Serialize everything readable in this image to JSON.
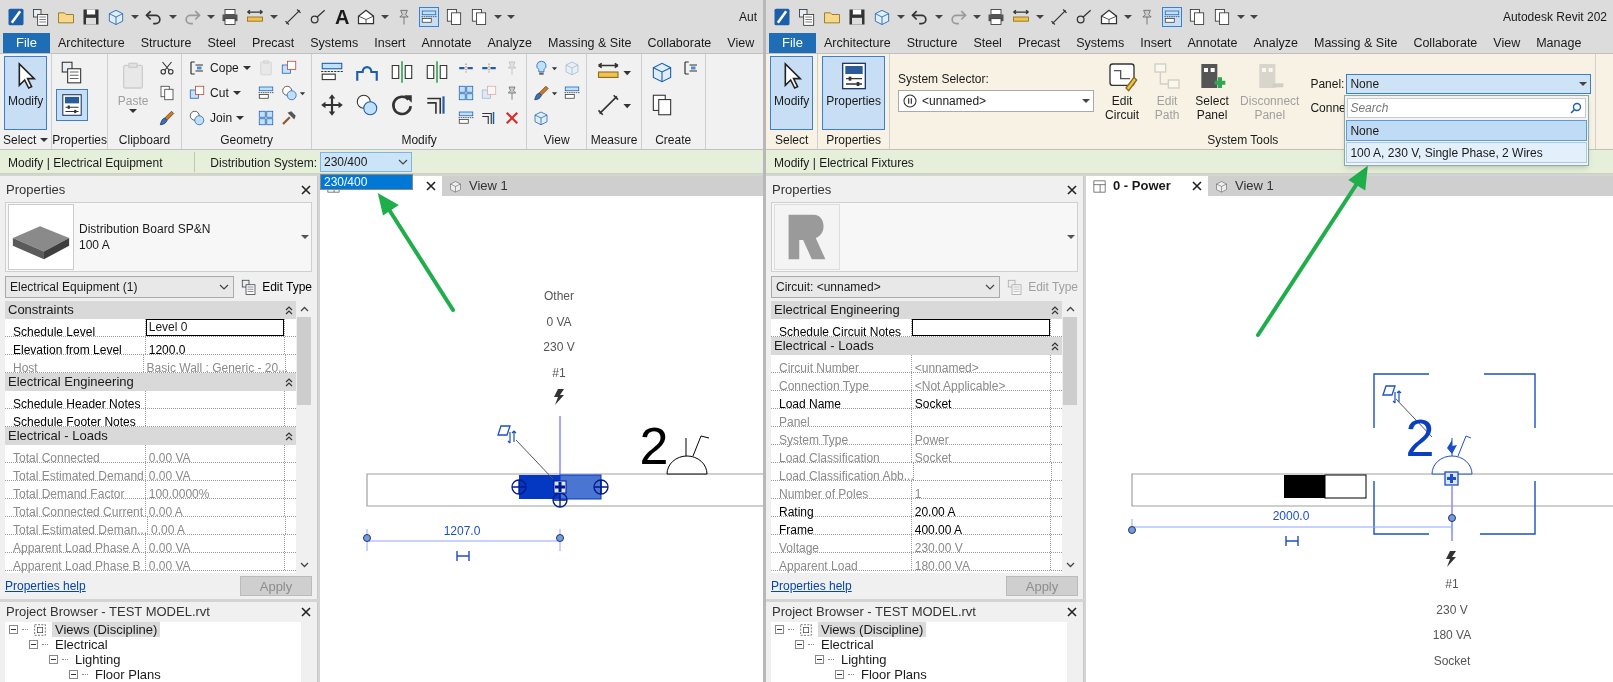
{
  "windows": [
    {
      "kind": "equipment",
      "title": "Aut",
      "text_tool": "A",
      "ribbon_tabs": [
        {
          "label": "File",
          "kind": "file",
          "selected": false
        },
        {
          "label": "Architecture",
          "kind": "tab",
          "selected": false
        },
        {
          "label": "Structure",
          "kind": "tab",
          "selected": false
        },
        {
          "label": "Steel",
          "kind": "tab",
          "selected": false
        },
        {
          "label": "Precast",
          "kind": "tab",
          "selected": false
        },
        {
          "label": "Systems",
          "kind": "tab",
          "selected": false
        },
        {
          "label": "Insert",
          "kind": "tab",
          "selected": false
        },
        {
          "label": "Annotate",
          "kind": "tab",
          "selected": false
        },
        {
          "label": "Analyze",
          "kind": "tab",
          "selected": false
        },
        {
          "label": "Massing & Site",
          "kind": "tab",
          "selected": false
        },
        {
          "label": "Collaborate",
          "kind": "tab",
          "selected": false
        },
        {
          "label": "View",
          "kind": "tab",
          "selected": false
        }
      ],
      "ribbon_panels": [
        {
          "title": "Select",
          "title_dropdown": true,
          "columns": [
            [
              {
                "kind": "large",
                "label": "Modify",
                "active": true,
                "disabled": false,
                "dropdown": false
              }
            ]
          ]
        },
        {
          "title": "Properties",
          "title_dropdown": false,
          "columns": [
            [
              {
                "kind": "medium",
                "active": false,
                "disabled": false,
                "dropdown": false
              },
              {
                "kind": "medium",
                "active": true,
                "disabled": false,
                "dropdown": false
              }
            ]
          ]
        },
        {
          "title": "Clipboard",
          "title_dropdown": false,
          "columns": [
            [
              {
                "kind": "large",
                "label": "Paste",
                "active": false,
                "disabled": true,
                "dropdown": true
              }
            ],
            [
              {
                "kind": "icon",
                "active": false,
                "disabled": false,
                "dropdown": false
              },
              {
                "kind": "icon",
                "active": false,
                "disabled": false,
                "dropdown": false
              },
              {
                "kind": "icon",
                "active": false,
                "disabled": false,
                "dropdown": false
              }
            ]
          ]
        },
        {
          "title": "Geometry",
          "title_dropdown": false,
          "columns": [
            [
              {
                "kind": "small",
                "label": "Cope",
                "active": false,
                "disabled": false,
                "dropdown": true
              },
              {
                "kind": "small",
                "label": "Cut",
                "active": false,
                "disabled": false,
                "dropdown": true
              },
              {
                "kind": "small",
                "label": "Join",
                "active": false,
                "disabled": false,
                "dropdown": true
              }
            ],
            [
              {
                "kind": "icon",
                "active": false,
                "disabled": true,
                "dropdown": false
              },
              {
                "kind": "icon",
                "active": false,
                "disabled": false,
                "dropdown": false
              },
              {
                "kind": "icon",
                "active": false,
                "disabled": false,
                "dropdown": false
              }
            ],
            [
              {
                "kind": "icon",
                "active": false,
                "disabled": false,
                "dropdown": false
              },
              {
                "kind": "icon",
                "active": false,
                "disabled": false,
                "dropdown": true
              },
              {
                "kind": "icon",
                "active": false,
                "disabled": false,
                "dropdown": false
              }
            ]
          ]
        },
        {
          "title": "Modify",
          "title_dropdown": false,
          "columns": [
            [
              {
                "kind": "medium",
                "active": false,
                "disabled": false,
                "dropdown": false
              },
              {
                "kind": "medium",
                "active": false,
                "disabled": false,
                "dropdown": false
              }
            ],
            [
              {
                "kind": "medium",
                "active": false,
                "disabled": false,
                "dropdown": false
              },
              {
                "kind": "medium",
                "active": false,
                "disabled": false,
                "dropdown": false
              }
            ],
            [
              {
                "kind": "medium",
                "active": false,
                "disabled": false,
                "dropdown": false
              },
              {
                "kind": "medium",
                "active": false,
                "disabled": false,
                "dropdown": false
              }
            ],
            [
              {
                "kind": "medium",
                "active": false,
                "disabled": false,
                "dropdown": false
              },
              {
                "kind": "medium",
                "active": false,
                "disabled": false,
                "dropdown": false
              }
            ],
            [
              {
                "kind": "icon",
                "active": false,
                "disabled": false,
                "dropdown": false
              },
              {
                "kind": "icon",
                "active": false,
                "disabled": false,
                "dropdown": false
              },
              {
                "kind": "icon",
                "active": false,
                "disabled": false,
                "dropdown": false
              }
            ],
            [
              {
                "kind": "icon",
                "active": false,
                "disabled": false,
                "dropdown": false
              },
              {
                "kind": "icon",
                "active": false,
                "disabled": true,
                "dropdown": false
              },
              {
                "kind": "icon",
                "active": false,
                "disabled": false,
                "dropdown": false
              }
            ],
            [
              {
                "kind": "icon",
                "active": false,
                "disabled": true,
                "dropdown": false
              },
              {
                "kind": "icon",
                "active": false,
                "disabled": false,
                "dropdown": false
              },
              {
                "kind": "icon",
                "active": false,
                "disabled": false,
                "dropdown": false
              }
            ]
          ]
        },
        {
          "title": "View",
          "title_dropdown": false,
          "columns": [
            [
              {
                "kind": "icon",
                "active": false,
                "disabled": false,
                "dropdown": true
              },
              {
                "kind": "icon",
                "active": false,
                "disabled": false,
                "dropdown": true
              },
              {
                "kind": "icon",
                "active": false,
                "disabled": false,
                "dropdown": false
              }
            ],
            [
              {
                "kind": "icon",
                "active": false,
                "disabled": true,
                "dropdown": false
              },
              {
                "kind": "icon",
                "active": false,
                "disabled": false,
                "dropdown": false
              }
            ]
          ]
        },
        {
          "title": "Measure",
          "title_dropdown": false,
          "columns": [
            [
              {
                "kind": "medium",
                "active": false,
                "disabled": false,
                "dropdown": true
              },
              {
                "kind": "medium",
                "active": false,
                "disabled": false,
                "dropdown": true
              }
            ]
          ]
        },
        {
          "title": "Create",
          "title_dropdown": false,
          "columns": [
            [
              {
                "kind": "medium",
                "active": false,
                "disabled": false,
                "dropdown": false
              },
              {
                "kind": "medium",
                "active": false,
                "disabled": false,
                "dropdown": false
              }
            ],
            [
              {
                "kind": "icon",
                "active": false,
                "disabled": false,
                "dropdown": false
              }
            ]
          ]
        }
      ],
      "context_bar": {
        "label": "Modify | Electrical Equipment",
        "field_label": "Distribution System:",
        "value": "230/400",
        "options": [
          {
            "label": "230/400",
            "selected": true
          }
        ]
      },
      "properties": {
        "title": "Properties",
        "type_name": "Distribution Board SP&N",
        "type_detail": "100 A",
        "filter": "Electrical Equipment (1)",
        "edit_type": {
          "label": "Edit Type",
          "disabled": false
        },
        "groups": [
          {
            "title": "Constraints",
            "rows": [
              {
                "name": "Schedule Level",
                "value": "Level 0",
                "editable": true,
                "focused": true
              },
              {
                "name": "Elevation from Level",
                "value": "1200.0",
                "editable": true,
                "focused": false
              },
              {
                "name": "Host",
                "value": "Basic Wall : Generic - 20...",
                "editable": false,
                "focused": false
              }
            ]
          },
          {
            "title": "Electrical Engineering",
            "rows": [
              {
                "name": "Schedule Header Notes",
                "editable": true,
                "focused": false
              },
              {
                "name": "Schedule Footer Notes",
                "editable": true,
                "focused": false
              }
            ]
          },
          {
            "title": "Electrical - Loads",
            "rows": [
              {
                "name": "Total Connected",
                "value": "0.00 VA",
                "editable": false,
                "focused": false
              },
              {
                "name": "Total Estimated Demand",
                "value": "0.00 VA",
                "editable": false,
                "focused": false
              },
              {
                "name": "Total Demand Factor",
                "value": "100.0000%",
                "editable": false,
                "focused": false
              },
              {
                "name": "Total Connected Current",
                "value": "0.00 A",
                "editable": false,
                "focused": false
              },
              {
                "name": "Total Estimated Deman...",
                "value": "0.00 A",
                "editable": false,
                "focused": false
              },
              {
                "name": "Apparent Load Phase A",
                "value": "0.00 VA",
                "editable": false,
                "focused": false
              },
              {
                "name": "Apparent Load Phase B",
                "value": "0.00 VA",
                "editable": false,
                "focused": false
              }
            ]
          }
        ],
        "help": "Properties help",
        "apply": {
          "label": "Apply",
          "disabled": true
        }
      },
      "project_browser": {
        "title": "Project Browser - TEST MODEL.rvt",
        "tree": [
          {
            "label": "Views (Discipline)",
            "expanded": true,
            "selected": true,
            "children": [
              {
                "label": "Electrical",
                "expanded": true,
                "selected": false,
                "children": [
                  {
                    "label": "Lighting",
                    "expanded": true,
                    "selected": false,
                    "children": [
                      {
                        "label": "Floor Plans",
                        "expanded": true,
                        "selected": false
                      }
                    ]
                  }
                ]
              }
            ]
          }
        ]
      },
      "view_tabs": [
        {
          "kind": "plan",
          "selected": true
        },
        {
          "kind": "model",
          "label": "View 1",
          "selected": false
        }
      ],
      "canvas": {
        "tag_lines": [
          "Other",
          "0 VA",
          "230 V",
          "#1"
        ],
        "dimension": "1207.0",
        "count": "2"
      }
    },
    {
      "kind": "fixture",
      "title": "Autodesk Revit 202",
      "ribbon_tabs": [
        {
          "label": "File",
          "kind": "file",
          "selected": false
        },
        {
          "label": "Architecture",
          "kind": "tab",
          "selected": false
        },
        {
          "label": "Structure",
          "kind": "tab",
          "selected": false
        },
        {
          "label": "Steel",
          "kind": "tab",
          "selected": false
        },
        {
          "label": "Precast",
          "kind": "tab",
          "selected": false
        },
        {
          "label": "Systems",
          "kind": "tab",
          "selected": false
        },
        {
          "label": "Insert",
          "kind": "tab",
          "selected": false
        },
        {
          "label": "Annotate",
          "kind": "tab",
          "selected": false
        },
        {
          "label": "Analyze",
          "kind": "tab",
          "selected": false
        },
        {
          "label": "Massing & Site",
          "kind": "tab",
          "selected": false
        },
        {
          "label": "Collaborate",
          "kind": "tab",
          "selected": false
        },
        {
          "label": "View",
          "kind": "tab",
          "selected": false
        },
        {
          "label": "Manage",
          "kind": "tab",
          "selected": false
        }
      ],
      "ribbon_panels": [
        {
          "title": "Select",
          "title_dropdown": false,
          "columns": [
            [
              {
                "kind": "large",
                "label": "Modify",
                "active": true,
                "disabled": false,
                "dropdown": false
              }
            ]
          ]
        },
        {
          "title": "Properties",
          "title_dropdown": false,
          "columns": [
            [
              {
                "kind": "large",
                "label": "Properties",
                "active": true,
                "disabled": false,
                "dropdown": false
              }
            ]
          ]
        },
        {
          "title": "System Tools",
          "title_dropdown": false,
          "columns": [
            [
              {
                "kind": "selector",
                "label": "System Selector:",
                "value": "<unnamed>"
              }
            ],
            [
              {
                "kind": "large",
                "label": "Edit Circuit",
                "active": false,
                "disabled": false,
                "dropdown": false
              }
            ],
            [
              {
                "kind": "large",
                "label": "Edit Path",
                "active": false,
                "disabled": true,
                "dropdown": false
              }
            ],
            [
              {
                "kind": "large",
                "label": "Select Panel",
                "active": false,
                "disabled": false,
                "dropdown": false
              }
            ],
            [
              {
                "kind": "large",
                "label": "Disconnect Panel",
                "active": false,
                "disabled": true,
                "dropdown": false
              }
            ],
            [
              {
                "kind": "panel_field",
                "label": "Panel:",
                "value": "None",
                "below_label": "Conne",
                "search_placeholder": "Search",
                "options": [
                  {
                    "label": "None",
                    "selected": true
                  },
                  {
                    "label": "100 A, 230 V, Single Phase, 2 Wires",
                    "selected": false
                  }
                ]
              }
            ]
          ]
        }
      ],
      "context_bar": {
        "label": "Modify | Electrical Fixtures"
      },
      "properties": {
        "title": "Properties",
        "filter": "Circuit: <unnamed>",
        "edit_type": {
          "label": "Edit Type",
          "disabled": true
        },
        "groups": [
          {
            "title": "Electrical Engineering",
            "rows": [
              {
                "name": "Schedule Circuit Notes",
                "editable": true,
                "focused": true
              }
            ]
          },
          {
            "title": "Electrical - Loads",
            "rows": [
              {
                "name": "Circuit Number",
                "value": "<unnamed>",
                "editable": false,
                "focused": false
              },
              {
                "name": "Connection Type",
                "value": "<Not Applicable>",
                "editable": false,
                "focused": false
              },
              {
                "name": "Load Name",
                "value": "Socket",
                "editable": true,
                "focused": false
              },
              {
                "name": "Panel",
                "editable": false,
                "focused": false
              },
              {
                "name": "System Type",
                "value": "Power",
                "editable": false,
                "focused": false
              },
              {
                "name": "Load Classification",
                "value": "Socket",
                "editable": false,
                "focused": false
              },
              {
                "name": "Load Classification Abb...",
                "editable": false,
                "focused": false
              },
              {
                "name": "Number of Poles",
                "value": "1",
                "editable": false,
                "focused": false
              },
              {
                "name": "Rating",
                "value": "20.00 A",
                "editable": true,
                "focused": false
              },
              {
                "name": "Frame",
                "value": "400.00 A",
                "editable": true,
                "focused": false
              },
              {
                "name": "Voltage",
                "value": "230.00 V",
                "editable": false,
                "focused": false
              },
              {
                "name": "Apparent Load",
                "value": "180.00 VA",
                "editable": false,
                "focused": false
              }
            ]
          }
        ],
        "help": "Properties help",
        "apply": {
          "label": "Apply",
          "disabled": true
        }
      },
      "project_browser": {
        "title": "Project Browser - TEST MODEL.rvt",
        "tree": [
          {
            "label": "Views (Discipline)",
            "expanded": true,
            "selected": true,
            "children": [
              {
                "label": "Electrical",
                "expanded": true,
                "selected": false,
                "children": [
                  {
                    "label": "Lighting",
                    "expanded": true,
                    "selected": false,
                    "children": [
                      {
                        "label": "Floor Plans",
                        "expanded": true,
                        "selected": false
                      }
                    ]
                  }
                ]
              }
            ]
          }
        ]
      },
      "view_tabs": [
        {
          "kind": "plan",
          "label": "0 - Power",
          "selected": true
        },
        {
          "kind": "model",
          "label": "View 1",
          "selected": false
        }
      ],
      "canvas": {
        "tag_lines": [
          "#1",
          "230 V",
          "180 VA",
          "Socket"
        ],
        "dimension": "2000.0",
        "count": "2"
      }
    }
  ]
}
